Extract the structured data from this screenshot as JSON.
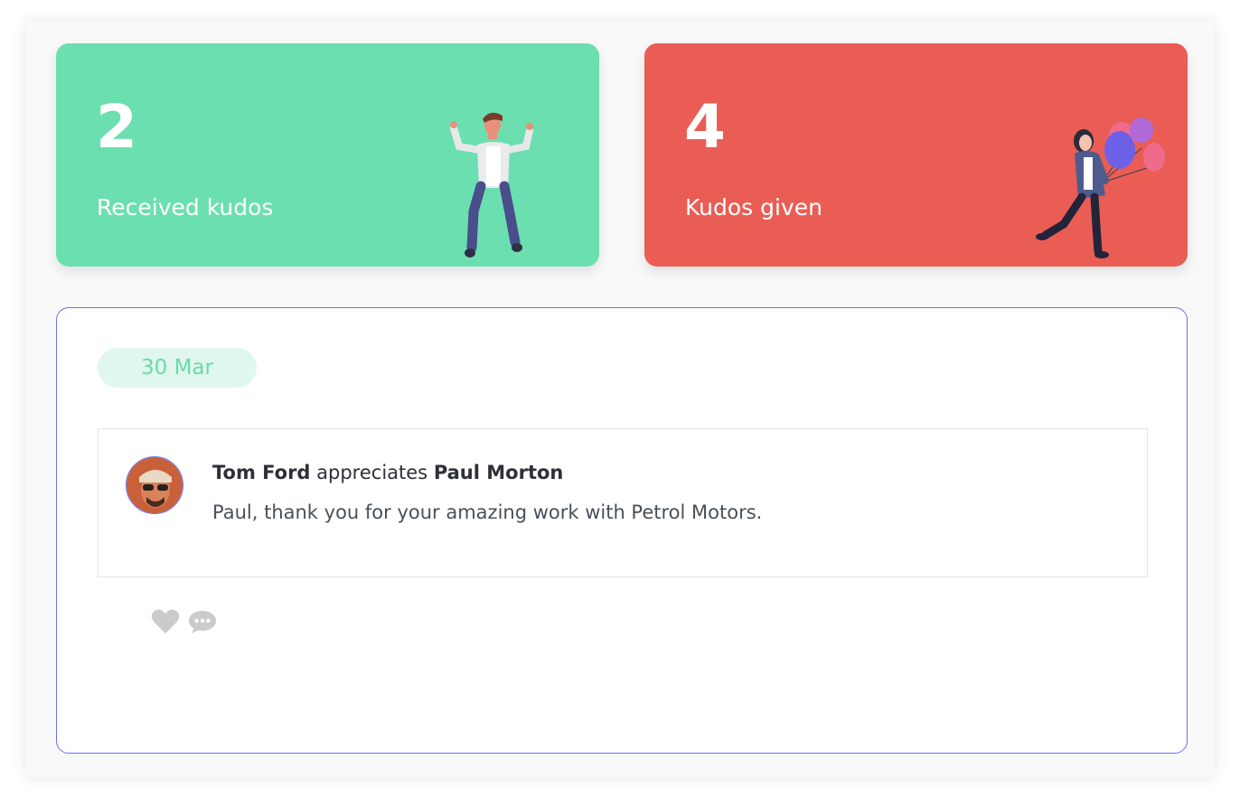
{
  "stats": {
    "received": {
      "count": "2",
      "label": "Received kudos",
      "color": "#6cdfb1",
      "illustration": "dancing-man-illustration"
    },
    "given": {
      "count": "4",
      "label": "Kudos given",
      "color": "#ea5d55",
      "illustration": "woman-with-balloons-illustration"
    }
  },
  "feed": {
    "date": "30 Mar",
    "border_color": "#6b6ff0",
    "items": [
      {
        "from": "Tom Ford",
        "verb": "appreciates",
        "to": "Paul Morton",
        "message": "Paul, thank you for your amazing work with Petrol Motors.",
        "avatar": "avatar-icon"
      }
    ],
    "actions": {
      "like_icon": "heart-icon",
      "comment_icon": "comment-icon"
    }
  }
}
